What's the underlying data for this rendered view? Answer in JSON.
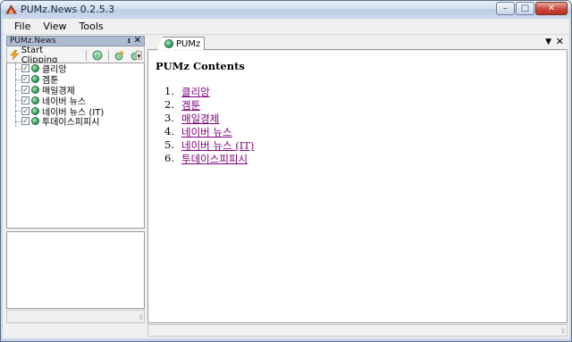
{
  "window": {
    "title": "PUMz.News 0.2.5.3"
  },
  "window_controls": {
    "minimize": "–",
    "maximize": "□",
    "close": "✕"
  },
  "menu": [
    "File",
    "View",
    "Tools"
  ],
  "left_panel": {
    "title": "PUMz.News",
    "pin_glyph": "ᵻ",
    "close_glyph": "✕",
    "toolbar": {
      "start_clipping": "Start Clipping"
    },
    "feeds": [
      {
        "label": "클리앙",
        "checked": true
      },
      {
        "label": "겜툰",
        "checked": true
      },
      {
        "label": "매일경제",
        "checked": true
      },
      {
        "label": "네이버 뉴스",
        "checked": true
      },
      {
        "label": "네이버 뉴스 (IT)",
        "checked": true
      },
      {
        "label": "투데이스피피시",
        "checked": true
      }
    ]
  },
  "document": {
    "tab_label": "PUMz",
    "title": "PUMz Contents",
    "items": [
      {
        "num": "1.",
        "label": "클리앙"
      },
      {
        "num": "2.",
        "label": "겜툰"
      },
      {
        "num": "3.",
        "label": "매일경제"
      },
      {
        "num": "4.",
        "label": "네이버 뉴스"
      },
      {
        "num": "5.",
        "label": "네이버 뉴스 (IT)"
      },
      {
        "num": "6.",
        "label": "투데이스피피시"
      }
    ]
  },
  "colors": {
    "link_visited": "#800080",
    "panel_header": "#aebbd1",
    "title_bar": "#c7d6e8"
  }
}
